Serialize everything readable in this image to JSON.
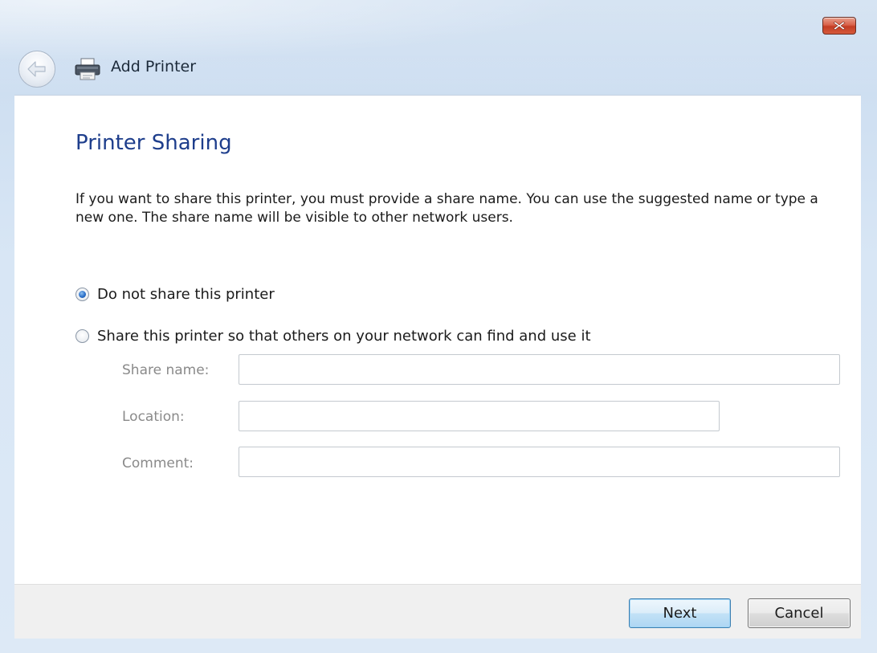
{
  "window": {
    "title": "Add Printer",
    "close_icon": "close-x-icon",
    "back_icon": "back-arrow-icon",
    "title_icon": "printer-icon"
  },
  "page": {
    "heading": "Printer Sharing",
    "description": "If you want to share this printer, you must provide a share name. You can use the suggested name or type a new one. The share name will be visible to other network users."
  },
  "sharing_options": {
    "selected": "do_not_share",
    "do_not_share_label": "Do not share this printer",
    "share_label": "Share this printer so that others on your network can find and use it"
  },
  "fields": {
    "share_name_label": "Share name:",
    "share_name_value": "",
    "location_label": "Location:",
    "location_value": "",
    "comment_label": "Comment:",
    "comment_value": ""
  },
  "buttons": {
    "next_label": "Next",
    "cancel_label": "Cancel"
  },
  "colors": {
    "heading": "#1e3e8c",
    "close_button": "#c33d24",
    "next_button_border": "#3c7fb1"
  }
}
